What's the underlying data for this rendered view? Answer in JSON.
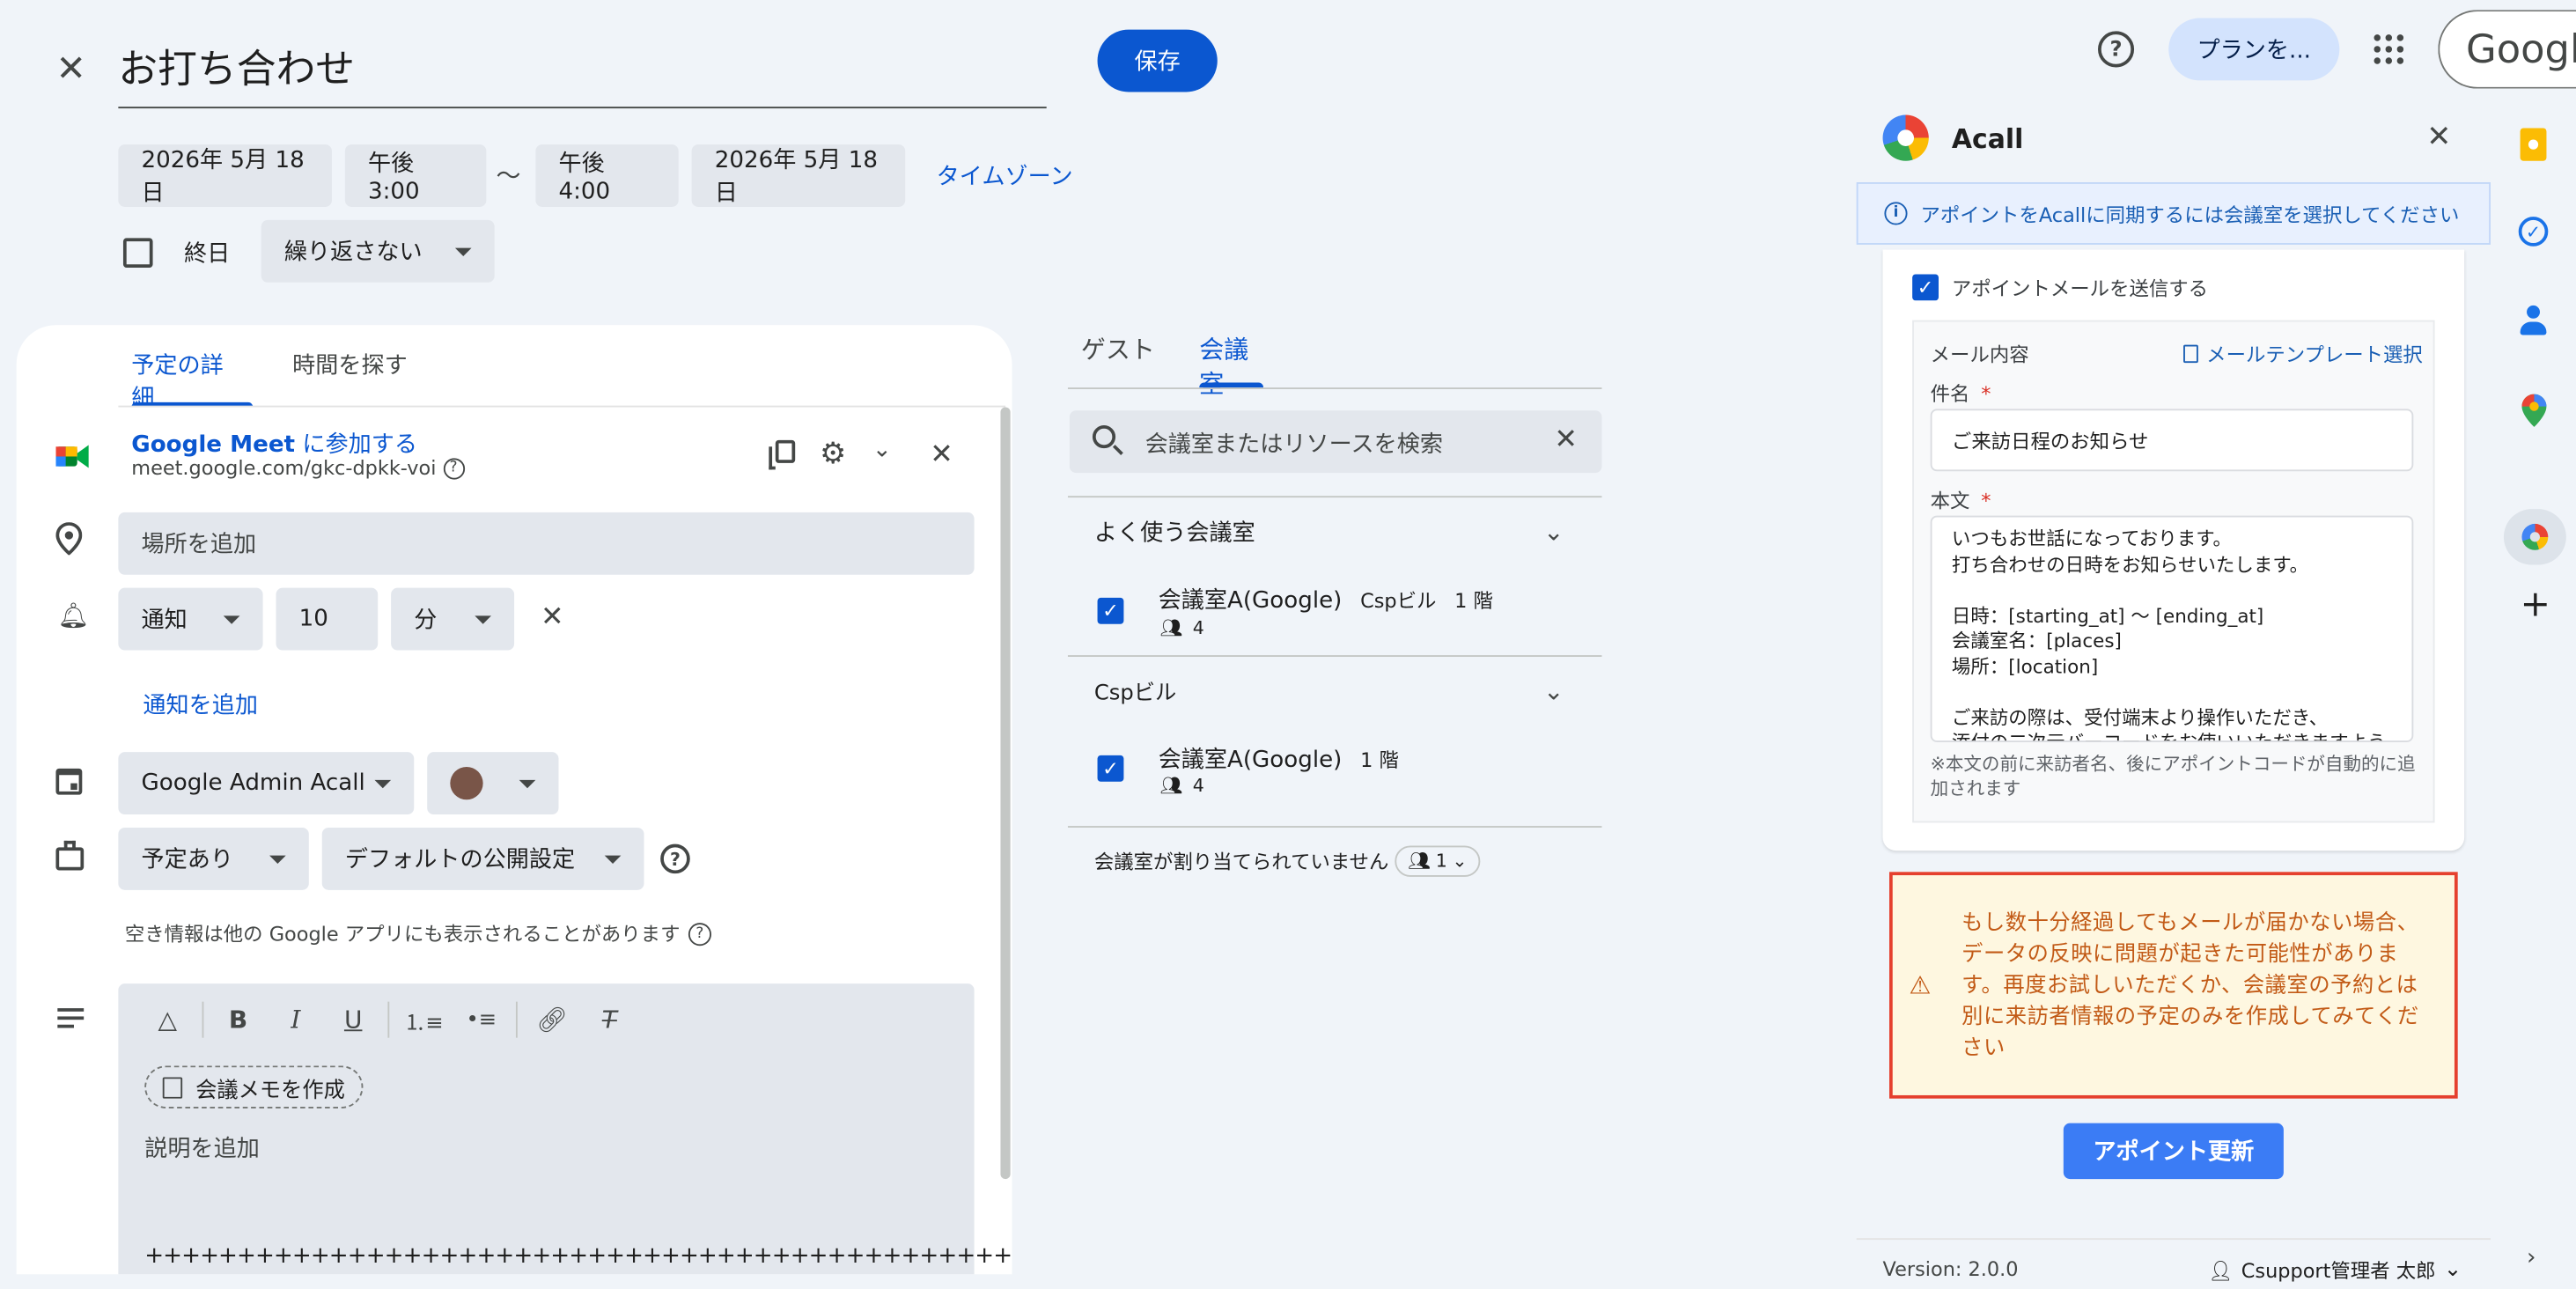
{
  "header": {
    "title": "お打ち合わせ",
    "save_label": "保存",
    "start_date": "2026年 5月 18日",
    "start_time": "午後3:00",
    "range_sep": "〜",
    "end_time": "午後4:00",
    "end_date": "2026年 5月 18日",
    "timezone_label": "タイムゾーン",
    "all_day_label": "終日",
    "repeat_label": "繰り返さない"
  },
  "topbar": {
    "plan_label": "プランを...",
    "google_label": "Google"
  },
  "details": {
    "tabs": [
      "予定の詳細",
      "時間を探す"
    ],
    "meet_link_brand": "Google Meet",
    "meet_link_text": " に参加する",
    "meet_url": "meet.google.com/gkc-dpkk-voi",
    "location_placeholder": "場所を追加",
    "notify_type": "通知",
    "notify_value": "10",
    "notify_unit": "分",
    "add_notification": "通知を追加",
    "calendar_name": "Google Admin Acall",
    "busy_label": "予定あり",
    "visibility_label": "デフォルトの公開設定",
    "availability_note": "空き情報は他の Google アプリにも表示されることがあります",
    "meeting_notes_label": "会議メモを作成",
    "description_placeholder": "説明を追加",
    "description_line": "+++++++++++++++++++++++++++++++++++++++++++++++"
  },
  "rooms": {
    "tabs": [
      "ゲスト",
      "会議室"
    ],
    "search_placeholder": "会議室またはリソースを検索",
    "frequent_header": "よく使う会議室",
    "room1_name": "会議室A(Google)",
    "room1_building": "Cspビル",
    "room1_floor": "1 階",
    "room1_capacity": "4",
    "building_header": "Cspビル",
    "room2_name": "会議室A(Google)",
    "room2_floor": "1 階",
    "room2_capacity": "4",
    "unassigned_label": "会議室が割り当てられていません",
    "unassigned_count": "1"
  },
  "acall": {
    "title": "Acall",
    "info_banner": "アポイントをAcallに同期するには会議室を選択してください",
    "send_mail_label": "アポイントメールを送信する",
    "mail_content_label": "メール内容",
    "mail_template_label": "メールテンプレート選択",
    "subject_label": "件名",
    "required_mark": "*",
    "subject_value": "ご来訪日程のお知らせ",
    "body_label": "本文",
    "body_lines": [
      "いつもお世話になっております。",
      "打ち合わせの日時をお知らせいたします。",
      "",
      "日時：[starting_at] 〜 [ending_at]",
      "会議室名：[places]",
      "場所：[location]",
      "",
      "ご来訪の際は、受付端末より操作いただき、",
      "添付の二次元バーコードをお使いいただきますよう"
    ],
    "body_note": "※本文の前に来訪者名、後にアポイントコードが自動的に追加されます",
    "warning_text": "もし数十分経過してもメールが届かない場合、データの反映に問題が起きた可能性があります。再度お試しいただくか、会議室の予約とは別に来訪者情報の予定のみを作成してみてください",
    "update_button": "アポイント更新",
    "version": "Version: 2.0.0",
    "user_name": "Csupport管理者 太郎"
  },
  "colors": {
    "accent": "#0b57d0",
    "acall_button": "#3b7cf5",
    "warning_border": "#e5402e",
    "warning_text": "#c25a16",
    "warning_bg": "#fef7e0",
    "calendar_color": "#795548"
  }
}
